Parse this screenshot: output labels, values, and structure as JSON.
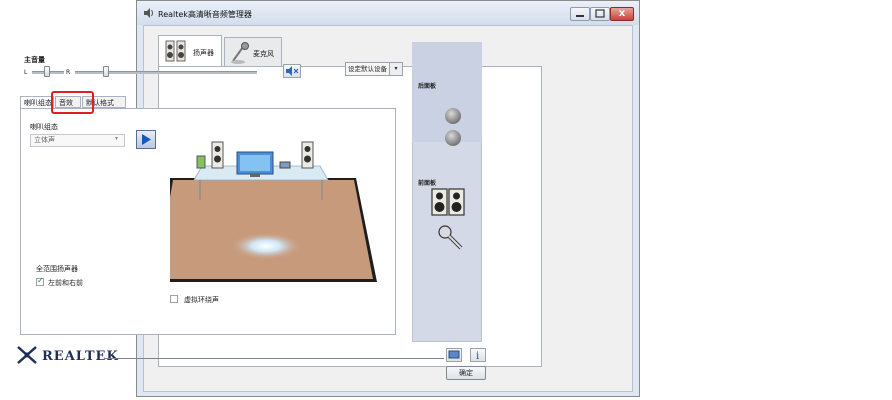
{
  "window": {
    "title": "Realtek高清晰音频管理器",
    "close_label": "x"
  },
  "device_tabs": [
    {
      "label": "扬声器",
      "selected": true,
      "icon": "speaker-icon"
    },
    {
      "label": "麦克风",
      "selected": false,
      "icon": "microphone-icon"
    }
  ],
  "master_volume": {
    "label": "主音量",
    "left_label": "L",
    "right_label": "R"
  },
  "default_device": {
    "label": "设定默认设备",
    "arrow": "▾"
  },
  "inner_tabs": [
    {
      "label": "喇叭组态",
      "selected": true
    },
    {
      "label": "音效",
      "selected": false,
      "highlighted": true
    },
    {
      "label": "默认格式",
      "selected": false
    }
  ],
  "speaker_config": {
    "label": "喇叭组态",
    "selected_value": "立体声",
    "play_icon": "play-icon"
  },
  "options": {
    "virtual_surround_label": "虚拟环绕声",
    "virtual_surround_checked": false,
    "fullrange_label": "全范围扬声器",
    "front_rear_label": "左前和右前",
    "front_rear_checked": true
  },
  "connectors": {
    "rear_label": "后面板",
    "front_label": "前面板"
  },
  "footer": {
    "brand": "REALTEK",
    "ok_label": "确定"
  },
  "colors": {
    "highlight": "#e02020",
    "floor": "#c79a7c",
    "brand": "#1f2f55"
  }
}
